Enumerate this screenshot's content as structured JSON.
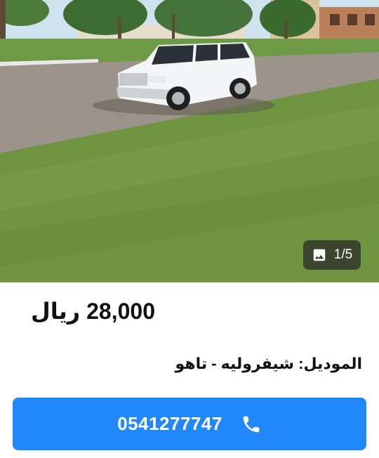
{
  "listing": {
    "photo_alt": "car-photo",
    "photo_counter": "1/5",
    "price": "28,000 ريال",
    "model_line": "الموديل: شيفروليه - تاهو",
    "call_number": "0541277747"
  },
  "colors": {
    "accent": "#2088fb",
    "counter_bg": "#282828"
  },
  "icons": [
    "image-icon",
    "phone-icon"
  ]
}
